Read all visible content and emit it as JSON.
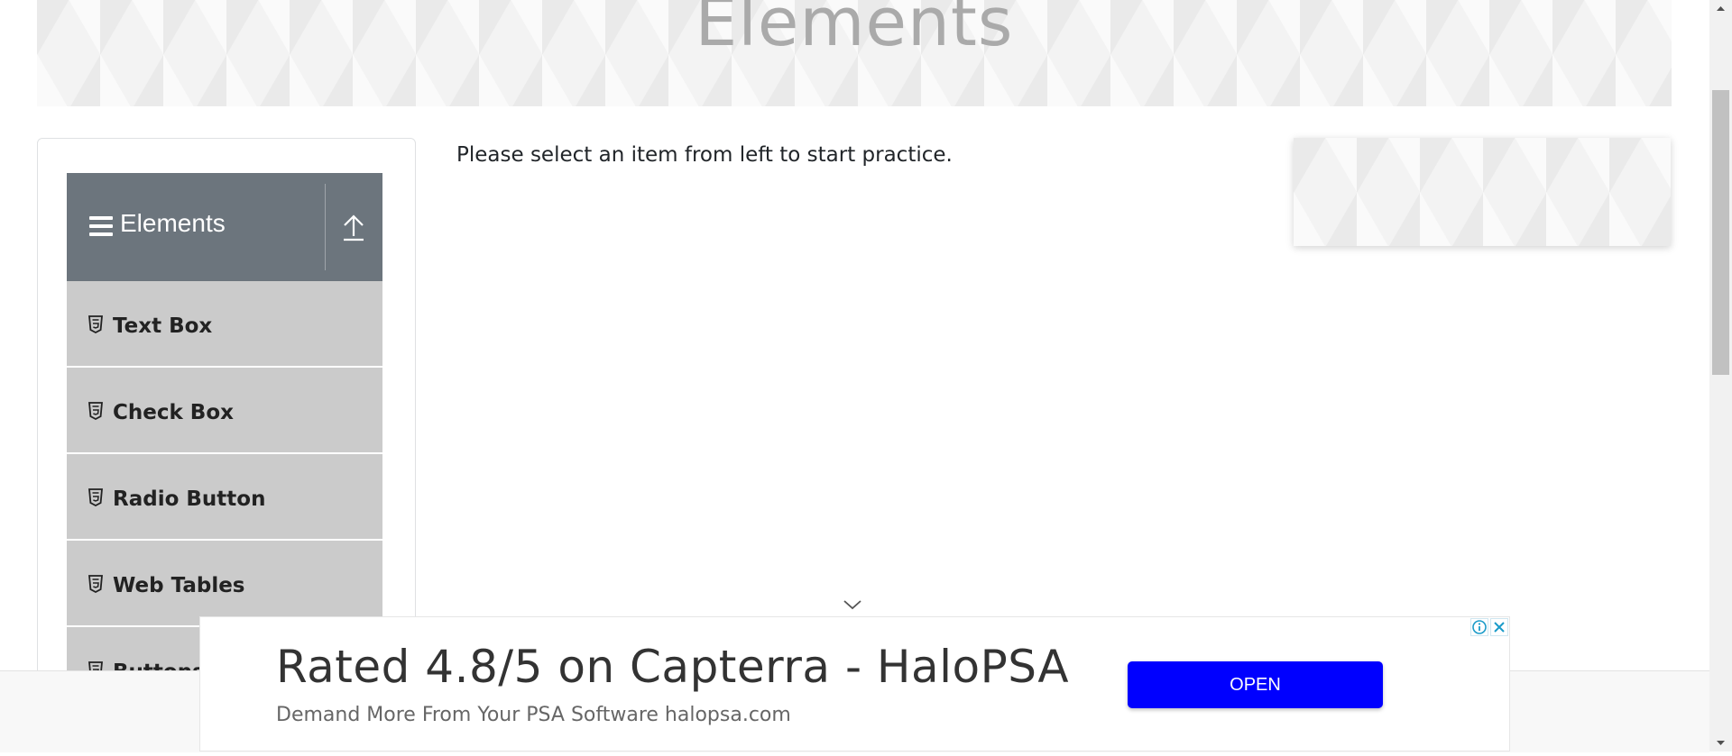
{
  "banner": {
    "title": "Elements"
  },
  "sidebar": {
    "group_title": "Elements",
    "items": [
      {
        "label": "Text Box"
      },
      {
        "label": "Check Box"
      },
      {
        "label": "Radio Button"
      },
      {
        "label": "Web Tables"
      },
      {
        "label": "Buttons"
      }
    ]
  },
  "main": {
    "intro": "Please select an item from left to start practice."
  },
  "ad": {
    "headline": "Rated 4.8/5 on Capterra - HaloPSA",
    "subtext": "Demand More From Your PSA Software halopsa.com",
    "button_label": "OPEN",
    "button_color": "#0000ff"
  },
  "colors": {
    "sidebar_header": "#6c757d",
    "sidebar_item": "#cbcbcb",
    "banner_text": "#aaaaaa"
  },
  "icons": {
    "menu": "hamburger-icon",
    "collapse": "arrow-up-icon",
    "item": "html5-icon",
    "ad_info": "info-icon",
    "ad_close": "close-icon",
    "ad_toggle": "chevron-down-icon"
  }
}
